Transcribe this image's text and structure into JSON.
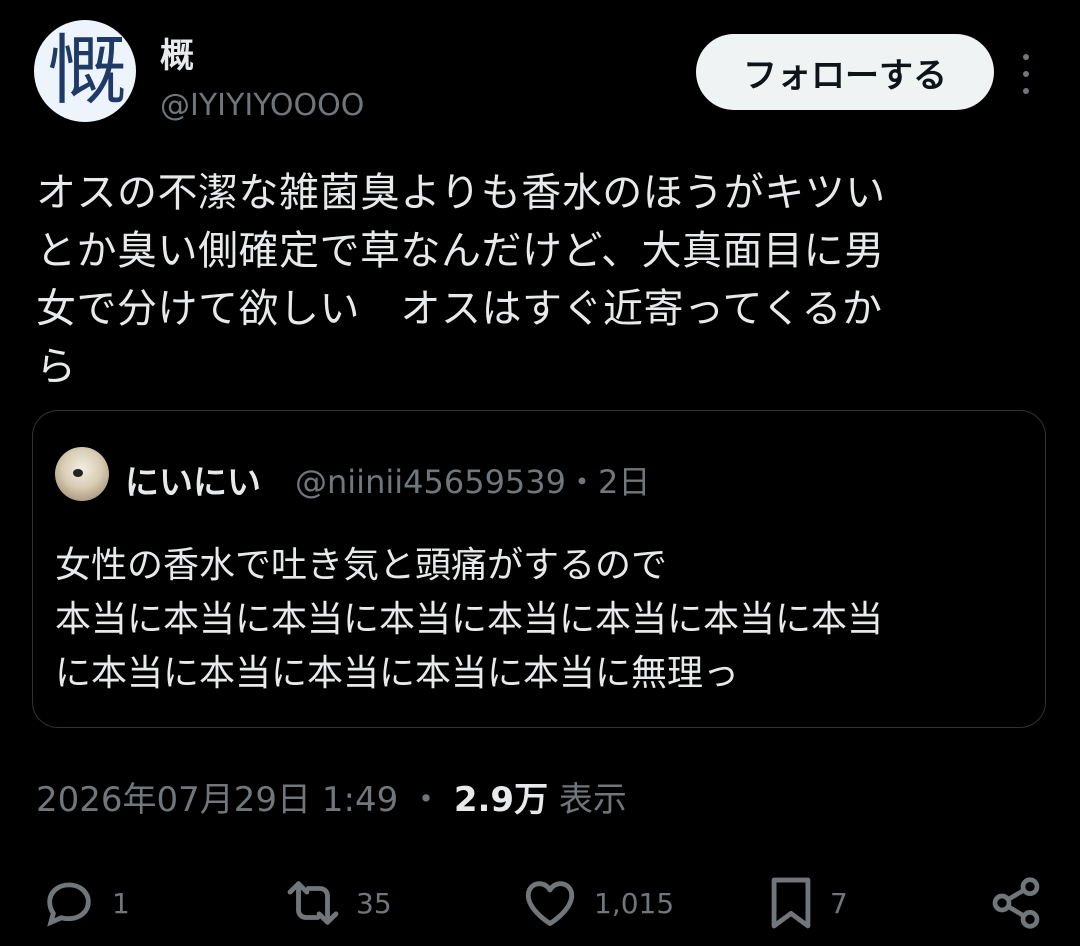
{
  "author": {
    "avatar_glyph": "慨",
    "display_name": "概",
    "handle": "@IYIYIYOOOO"
  },
  "follow_button_label": "フォローする",
  "tweet_text": "オスの不潔な雑菌臭よりも香水のほうがキツい\nとか臭い側確定で草なんだけど、大真面目に男\n女で分けて欲しい　オスはすぐ近寄ってくるか\nら",
  "quote": {
    "display_name": "にいにい",
    "handle": "@niinii45659539",
    "separator": "・",
    "time_ago": "2日",
    "text": "女性の香水で吐き気と頭痛がするので\n本当に本当に本当に本当に本当に本当に本当に本当\nに本当に本当に本当に本当に本当に無理っ"
  },
  "meta": {
    "timestamp": "2026年07月29日 1:49",
    "separator": "・",
    "views_count": "2.9万",
    "views_label": "表示"
  },
  "actions": {
    "reply_count": "1",
    "retweet_count": "35",
    "like_count": "1,015",
    "bookmark_count": "7",
    "icons": [
      "reply-icon",
      "retweet-icon",
      "like-icon",
      "bookmark-icon",
      "share-icon"
    ]
  },
  "colors": {
    "background": "#000000",
    "text_primary": "#e7e9ea",
    "text_secondary": "#71767b",
    "border": "#2f3336",
    "follow_button_bg": "#eff3f4"
  }
}
